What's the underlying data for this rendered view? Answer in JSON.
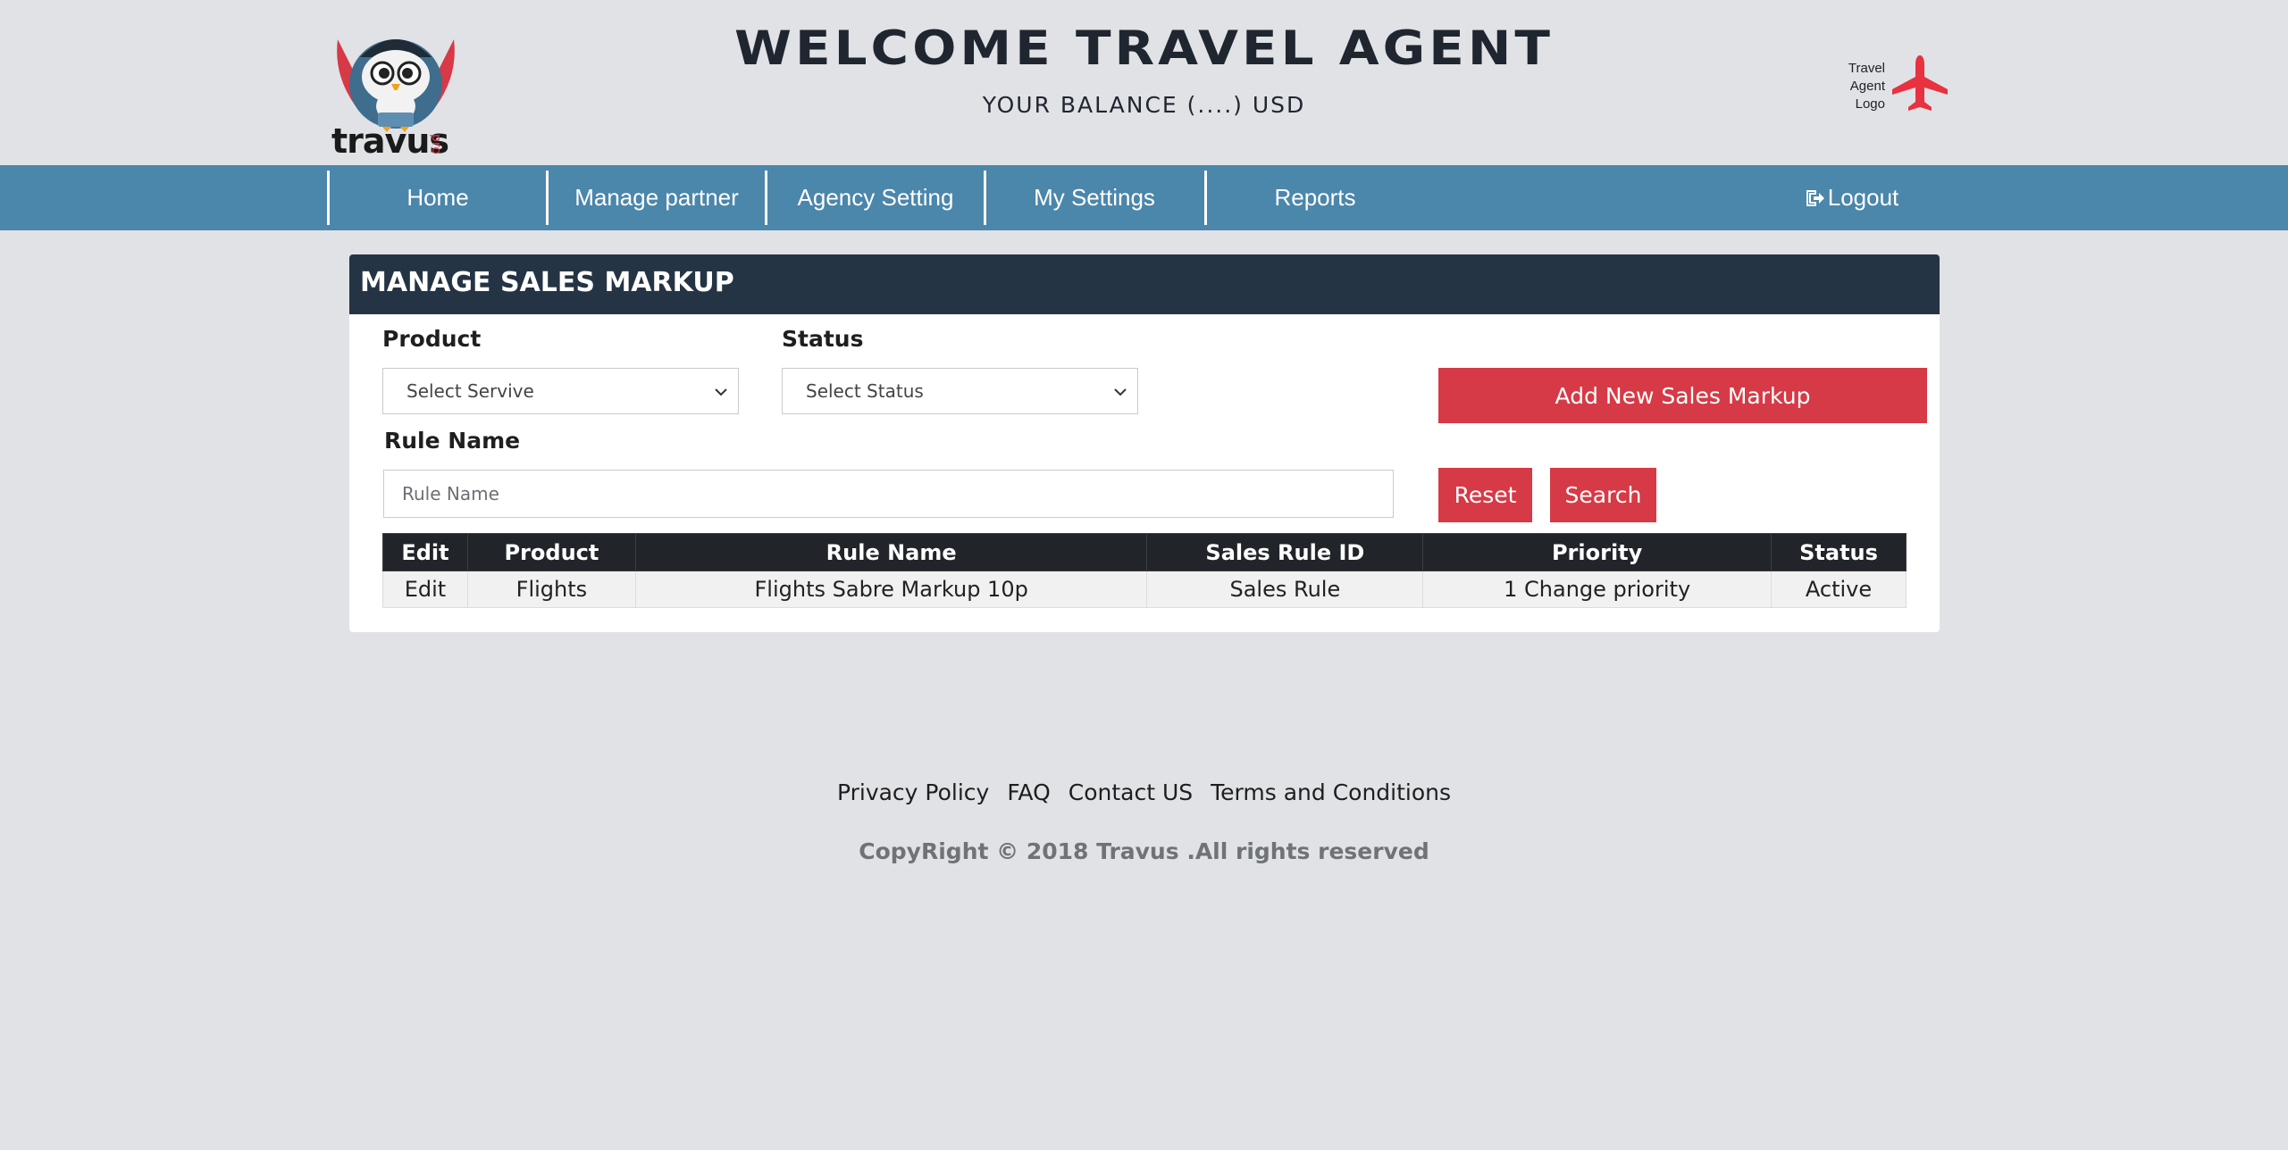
{
  "header": {
    "brand_name": "travus",
    "brand_suffix": "pro",
    "welcome_title": "WELCOME TRAVEL AGENT",
    "balance_line": "YOUR BALANCE (....) USD",
    "agent_logo_text": "Travel Agent Logo"
  },
  "nav": {
    "items": [
      {
        "label": "Home"
      },
      {
        "label": "Manage partner"
      },
      {
        "label": "Agency Setting"
      },
      {
        "label": "My Settings"
      },
      {
        "label": "Reports"
      }
    ],
    "logout_label": "Logout"
  },
  "panel": {
    "title": "MANAGE SALES MARKUP",
    "product_label": "Product",
    "product_select_value": "Select Servive",
    "status_label": "Status",
    "status_select_value": "Select Status",
    "rule_name_label": "Rule Name",
    "rule_name_placeholder": "Rule Name",
    "add_button_label": "Add New Sales Markup",
    "reset_button_label": "Reset",
    "search_button_label": "Search"
  },
  "table": {
    "headers": [
      "Edit",
      "Product",
      "Rule Name",
      "Sales Rule ID",
      "Priority",
      "Status"
    ],
    "rows": [
      [
        "Edit",
        "Flights",
        "Flights Sabre Markup 10p",
        "Sales Rule",
        "1 Change priority",
        "Active"
      ]
    ]
  },
  "footer": {
    "links": [
      "Privacy Policy",
      "FAQ",
      "Contact US",
      "Terms and Conditions"
    ],
    "copyright": "CopyRight © 2018 Travus .All rights reserved"
  },
  "colors": {
    "page_bg": "#e1e2e6",
    "nav_bg": "#4b86ab",
    "panel_header_bg": "#253444",
    "accent_red": "#d63a46",
    "table_header_bg": "#212529"
  },
  "icons": {
    "brand": "owl-mascot-icon",
    "agent": "airplane-icon",
    "logout": "sign-out-icon",
    "dropdown": "chevron-down-icon"
  }
}
